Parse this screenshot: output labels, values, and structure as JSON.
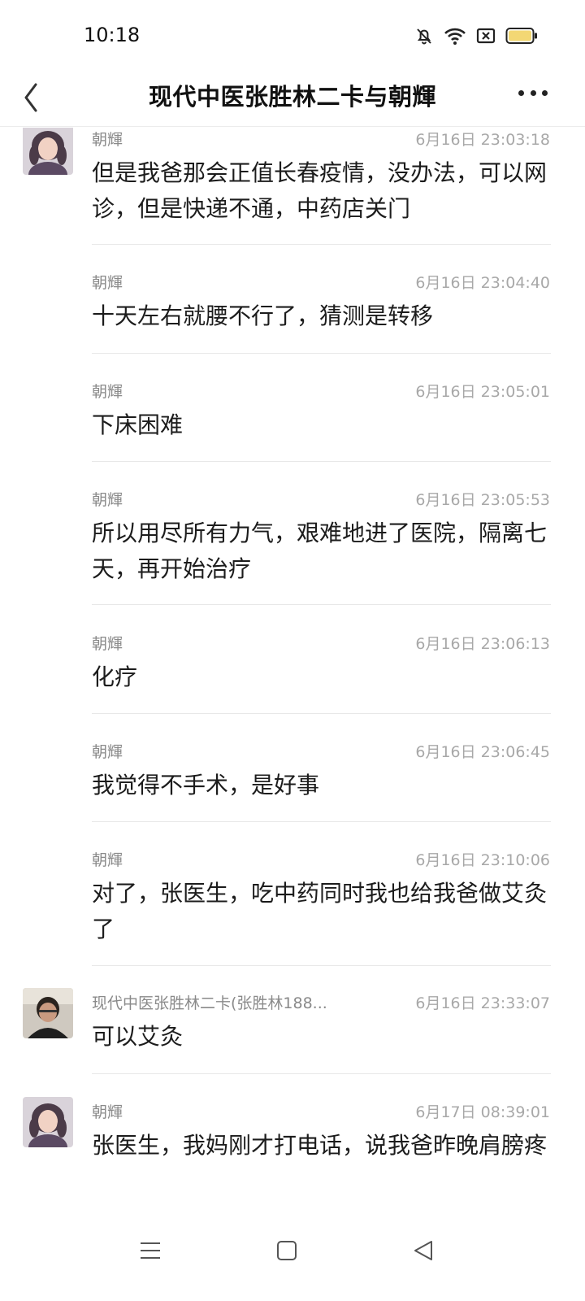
{
  "status_bar": {
    "time": "10:18"
  },
  "header": {
    "title": "现代中医张胜林二卡与朝輝"
  },
  "messages": [
    {
      "sender": "朝輝",
      "time": "6月16日 23:03:18",
      "text": "但是我爸那会正值长春疫情，没办法，可以网诊，但是快递不通，中药店关门"
    },
    {
      "sender": "朝輝",
      "time": "6月16日 23:04:40",
      "text": "十天左右就腰不行了，猜测是转移"
    },
    {
      "sender": "朝輝",
      "time": "6月16日 23:05:01",
      "text": "下床困难"
    },
    {
      "sender": "朝輝",
      "time": "6月16日 23:05:53",
      "text": "所以用尽所有力气，艰难地进了医院，隔离七天，再开始治疗"
    },
    {
      "sender": "朝輝",
      "time": "6月16日 23:06:13",
      "text": "化疗"
    },
    {
      "sender": "朝輝",
      "time": "6月16日 23:06:45",
      "text": "我觉得不手术，是好事"
    },
    {
      "sender": "朝輝",
      "time": "6月16日 23:10:06",
      "text": "对了，张医生，吃中药同时我也给我爸做艾灸了"
    },
    {
      "sender": "现代中医张胜林二卡(张胜林188...",
      "time": "6月16日 23:33:07",
      "text": "可以艾灸"
    },
    {
      "sender": "朝輝",
      "time": "6月17日 08:39:01",
      "text": "张医生，我妈刚才打电话，说我爸昨晚肩膀疼"
    }
  ],
  "icons": {
    "back": "chevron-left-icon",
    "more": "more-dots-icon",
    "mute": "bell-off-icon",
    "wifi": "wifi-icon",
    "no_sim": "sim-x-icon",
    "battery": "battery-icon",
    "nav_menu": "menu-icon",
    "nav_home": "home-square-icon",
    "nav_back": "back-triangle-icon"
  },
  "colors": {
    "battery_fill": "#f3d774",
    "divider": "#e8e8e8",
    "meta_text": "#a8a8a8"
  }
}
